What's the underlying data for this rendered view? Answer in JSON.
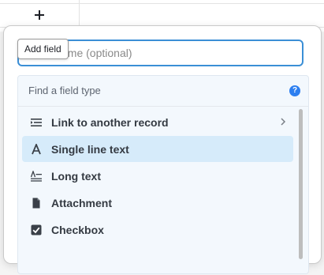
{
  "grid": {
    "add_symbol": "+"
  },
  "popover": {
    "tooltip": "Add field",
    "name_placeholder": "Field name (optional)",
    "search_placeholder": "Find a field type",
    "help_symbol": "?",
    "types": [
      {
        "label": "Link to another record",
        "icon": "link-record-icon",
        "has_submenu": true
      },
      {
        "label": "Single line text",
        "icon": "text-a-icon",
        "selected": true
      },
      {
        "label": "Long text",
        "icon": "long-text-icon"
      },
      {
        "label": "Attachment",
        "icon": "document-icon"
      },
      {
        "label": "Checkbox",
        "icon": "checkbox-icon"
      }
    ]
  },
  "colors": {
    "focus_border": "#3b8fd6",
    "selected_bg": "#d6ebfa",
    "help_blue": "#2d7ff0"
  }
}
